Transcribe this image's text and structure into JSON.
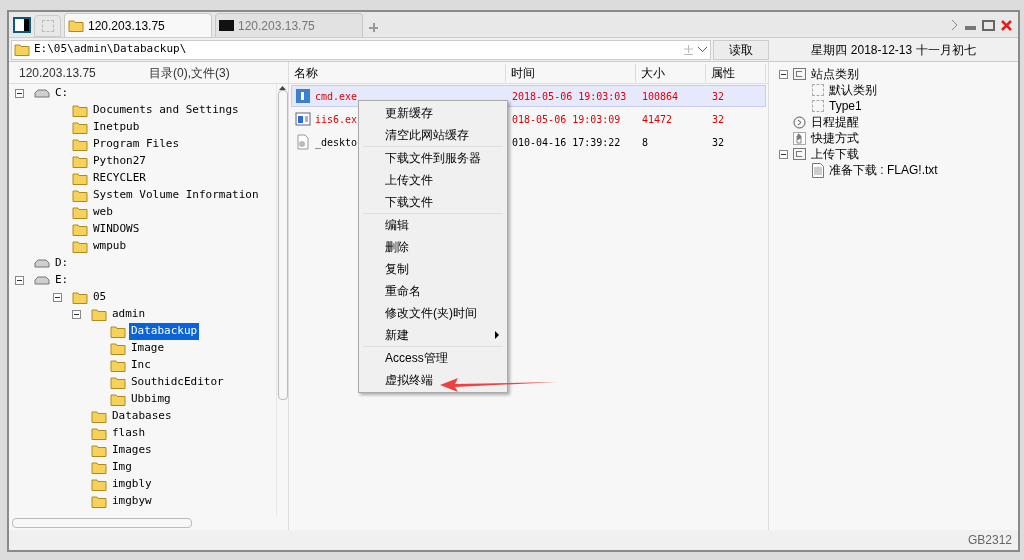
{
  "tabs": [
    {
      "kind": "folder",
      "label": "120.203.13.75",
      "selected": true
    },
    {
      "kind": "terminal",
      "label": "120.203.13.75",
      "selected": false
    }
  ],
  "address": {
    "value": "E:\\05\\admin\\Databackup\\",
    "read_button": "读取"
  },
  "date_line": "星期四 2018-12-13 十一月初七",
  "left_header": {
    "host": "120.203.13.75",
    "summary": "目录(0),文件(3)"
  },
  "tree": [
    {
      "kind": "drive",
      "label": "C:",
      "expanded": true,
      "selected": false,
      "children": [
        {
          "kind": "folder",
          "label": "Documents and Settings",
          "selected": false
        },
        {
          "kind": "folder",
          "label": "Inetpub",
          "selected": false
        },
        {
          "kind": "folder",
          "label": "Program Files",
          "selected": false
        },
        {
          "kind": "folder",
          "label": "Python27",
          "selected": false
        },
        {
          "kind": "folder",
          "label": "RECYCLER",
          "selected": false
        },
        {
          "kind": "folder",
          "label": "System Volume Information",
          "selected": false
        },
        {
          "kind": "folder",
          "label": "web",
          "selected": false
        },
        {
          "kind": "folder",
          "label": "WINDOWS",
          "selected": false
        },
        {
          "kind": "folder",
          "label": "wmpub",
          "selected": false
        }
      ]
    },
    {
      "kind": "drive",
      "label": "D:",
      "selected": false
    },
    {
      "kind": "drive",
      "label": "E:",
      "expanded": true,
      "selected": false,
      "children": [
        {
          "kind": "folder",
          "label": "05",
          "expanded": true,
          "selected": false,
          "children": [
            {
              "kind": "folder",
              "label": "admin",
              "expanded": true,
              "selected": false,
              "children": [
                {
                  "kind": "folder",
                  "label": "Databackup",
                  "selected": true
                },
                {
                  "kind": "folder",
                  "label": "Image",
                  "selected": false
                },
                {
                  "kind": "folder",
                  "label": "Inc",
                  "selected": false
                },
                {
                  "kind": "folder",
                  "label": "SouthidcEditor",
                  "selected": false
                },
                {
                  "kind": "folder",
                  "label": "Ubbimg",
                  "selected": false
                }
              ]
            },
            {
              "kind": "folder",
              "label": "Databases",
              "selected": false
            },
            {
              "kind": "folder",
              "label": "flash",
              "selected": false
            },
            {
              "kind": "folder",
              "label": "Images",
              "selected": false
            },
            {
              "kind": "folder",
              "label": "Img",
              "selected": false
            },
            {
              "kind": "folder",
              "label": "imgbly",
              "selected": false
            },
            {
              "kind": "folder",
              "label": "imgbyw",
              "selected": false
            }
          ]
        }
      ]
    }
  ],
  "table": {
    "columns": [
      "名称",
      "时间",
      "大小",
      "属性"
    ],
    "rows": [
      {
        "kind": "exe",
        "highlighted": true,
        "selected": true,
        "cells": [
          "cmd.exe",
          "2018-05-06 19:03:03",
          "100864",
          "32"
        ]
      },
      {
        "kind": "app",
        "highlighted": true,
        "selected": false,
        "cells": [
          "iis6.ex",
          "018-05-06 19:03:09",
          "41472",
          "32"
        ]
      },
      {
        "kind": "settings",
        "highlighted": false,
        "selected": false,
        "cells": [
          "_deskto",
          "010-04-16 17:39:22",
          "8",
          "32"
        ]
      }
    ]
  },
  "context_menu": [
    [
      {
        "label": "更新缓存"
      },
      {
        "label": "清空此网站缓存"
      }
    ],
    [
      {
        "label": "下载文件到服务器"
      },
      {
        "label": "上传文件"
      },
      {
        "label": "下载文件"
      }
    ],
    [
      {
        "label": "编辑"
      },
      {
        "label": "删除"
      },
      {
        "label": "复制"
      },
      {
        "label": "重命名"
      },
      {
        "label": "修改文件(夹)时间"
      },
      {
        "label": "新建",
        "submenu": true
      }
    ],
    [
      {
        "label": "Access管理"
      },
      {
        "label": "虚拟终端"
      }
    ]
  ],
  "side_tree": [
    {
      "kind": "category",
      "label": "站点类别",
      "expanded": true,
      "children": [
        {
          "kind": "item",
          "label": "默认类别"
        },
        {
          "kind": "item",
          "label": "Type1"
        }
      ]
    },
    {
      "kind": "clock",
      "label": "日程提醒"
    },
    {
      "kind": "hand",
      "label": "快捷方式"
    },
    {
      "kind": "category",
      "label": "上传下载",
      "expanded": true,
      "children": [
        {
          "kind": "file",
          "label": "准备下载 : FLAG!.txt"
        }
      ]
    }
  ],
  "status_bar": "GB2312"
}
